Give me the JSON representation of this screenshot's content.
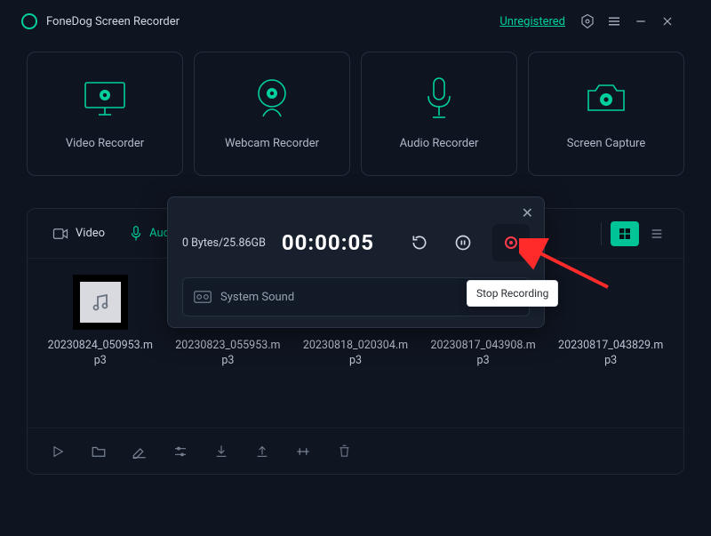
{
  "header": {
    "title": "FoneDog Screen Recorder",
    "status": "Unregistered"
  },
  "modes": [
    {
      "id": "video",
      "label": "Video Recorder"
    },
    {
      "id": "webcam",
      "label": "Webcam Recorder"
    },
    {
      "id": "audio",
      "label": "Audio Recorder"
    },
    {
      "id": "screen",
      "label": "Screen Capture"
    }
  ],
  "library": {
    "tabs": {
      "video": "Video",
      "audio": "Audio"
    },
    "active_tab": "video"
  },
  "files": [
    {
      "name": "20230824_050953.mp3"
    },
    {
      "name": "20230823_055953.mp3"
    },
    {
      "name": "20230818_020304.mp3"
    },
    {
      "name": "20230817_043908.mp3"
    },
    {
      "name": "20230817_043829.mp3"
    }
  ],
  "popup": {
    "size_text": "0 Bytes/25.86GB",
    "timer": "00:00:05",
    "source_label": "System Sound",
    "tooltip": "Stop Recording"
  },
  "colors": {
    "accent": "#01d09e",
    "stop": "#ff3b4a"
  }
}
